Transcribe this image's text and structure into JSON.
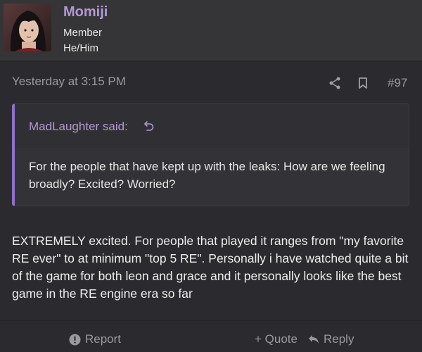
{
  "user": {
    "name": "Momiji",
    "role": "Member",
    "pronouns": "He/Him"
  },
  "post": {
    "timestamp": "Yesterday at 3:15 PM",
    "number": "#97",
    "quote": {
      "author_said": "MadLaughter said:",
      "text": "For the people that have kept up with the leaks: How are we feeling broadly? Excited? Worried?"
    },
    "body": "EXTREMELY excited. For people that played it ranges from \"my favorite RE ever\" to at minimum \"top 5 RE\". Personally i have watched quite a bit of the game for both leon and grace and it personally looks like the best game in the RE engine era so far"
  },
  "actions": {
    "report": "Report",
    "quote": "+ Quote",
    "reply": "Reply"
  },
  "icons": {
    "share": "share-icon",
    "bookmark": "bookmark-icon",
    "quote_jump": "quote-jump-icon",
    "report": "alert-circle-icon",
    "reply": "reply-arrow-icon"
  },
  "colors": {
    "accent": "#b399d4",
    "quote_border": "#8f6fc9",
    "background": "#2b2b2f",
    "muted_text": "#9a9a9e"
  }
}
